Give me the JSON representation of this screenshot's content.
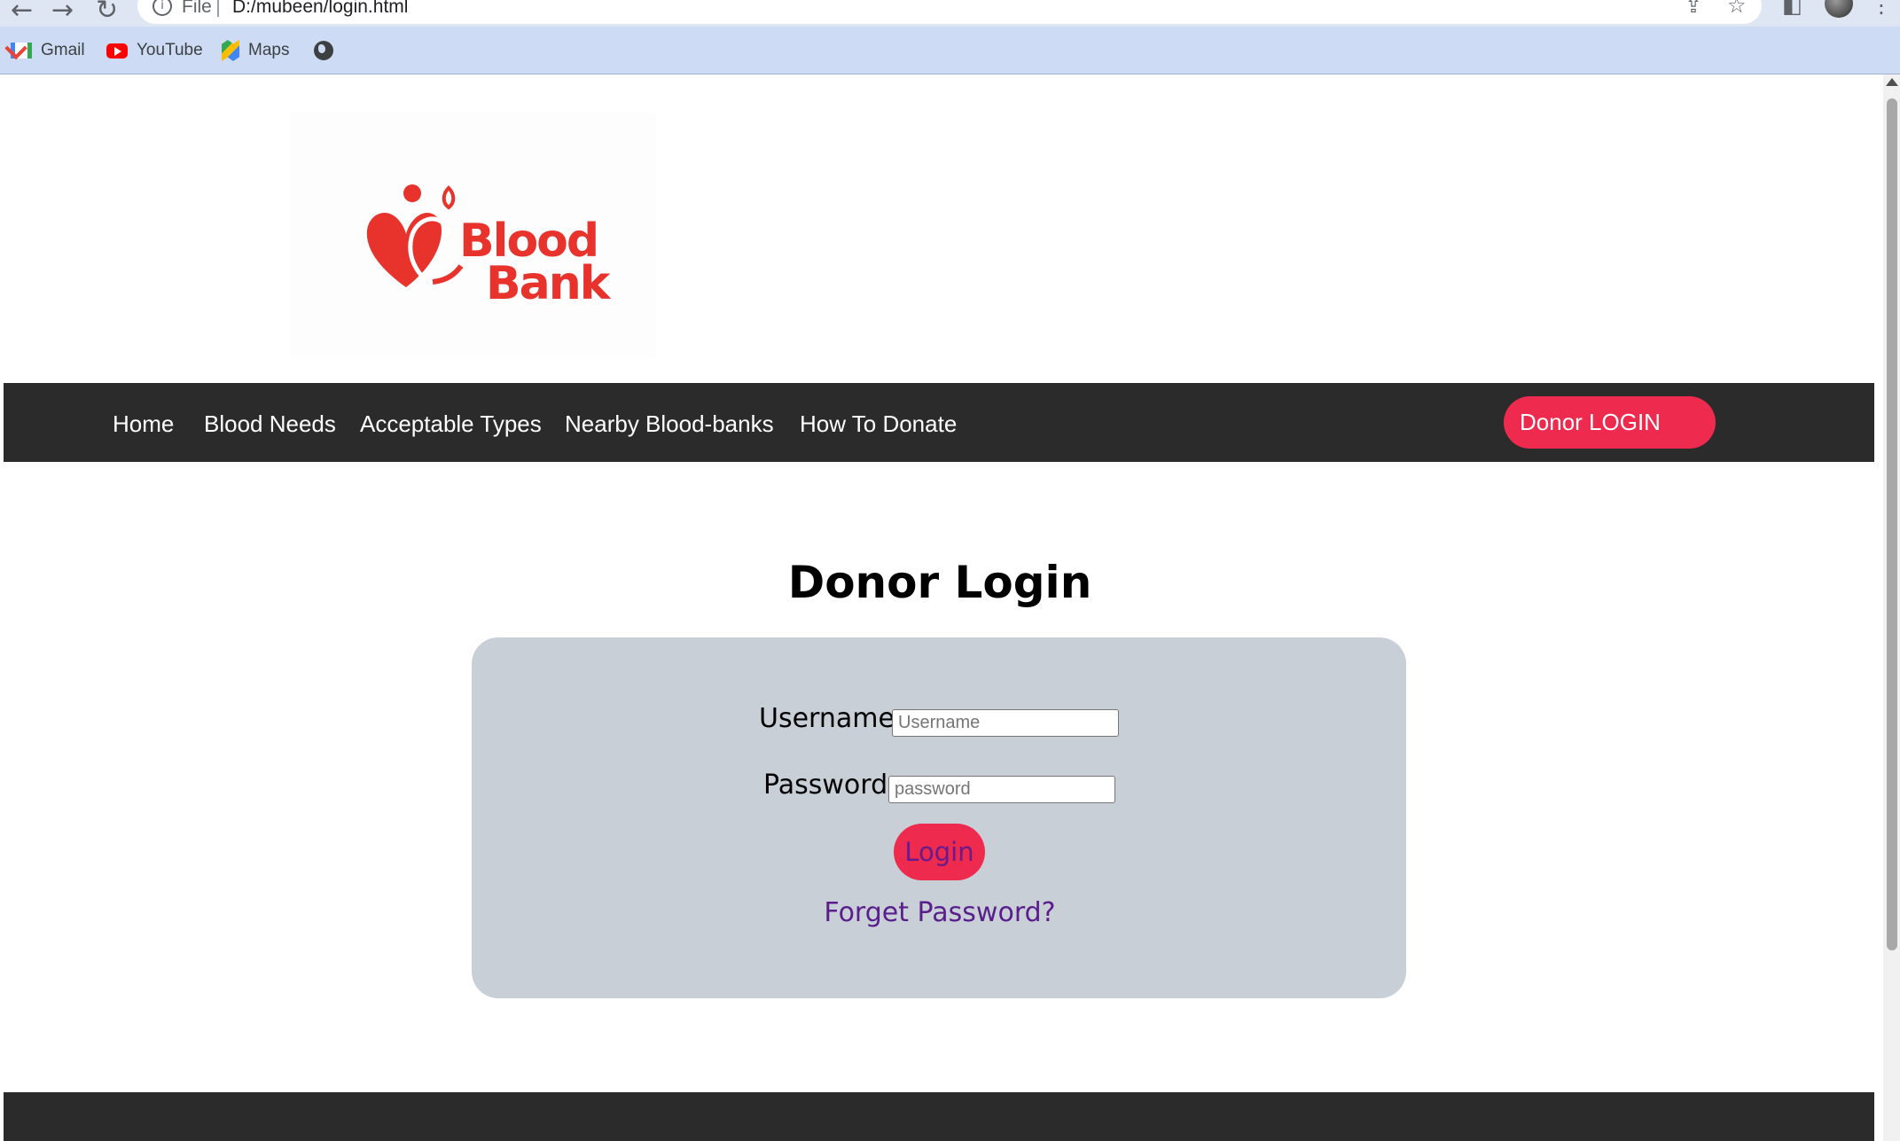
{
  "browser": {
    "back_icon": "arrow-left-icon",
    "forward_icon": "arrow-right-icon",
    "reload_icon": "reload-icon",
    "url_scheme_label": "File",
    "url": "D:/mubeen/login.html",
    "bookmarks": [
      {
        "label": "Gmail",
        "icon": "gmail-icon"
      },
      {
        "label": "YouTube",
        "icon": "youtube-icon"
      },
      {
        "label": "Maps",
        "icon": "maps-icon"
      },
      {
        "label": "",
        "icon": "globe-icon"
      }
    ]
  },
  "logo": {
    "line1": "Blood",
    "line2": "Bank",
    "color": "#e8322c"
  },
  "nav": {
    "links": [
      "Home",
      "Blood Needs",
      "Acceptable Types",
      "Nearby Blood-banks",
      "How To Donate"
    ],
    "donor_button": "Donor LOGIN"
  },
  "login": {
    "title": "Donor Login",
    "username_label": "Username:",
    "username_placeholder": "Username",
    "password_label": "Password",
    "password_placeholder": "password",
    "submit_label": "Login",
    "forget_label": "Forget Password?"
  },
  "colors": {
    "accent": "#ee2a4e",
    "nav_bg": "#2b2b2b",
    "card_bg": "#c8cfd7",
    "link": "#5a1e8c"
  }
}
